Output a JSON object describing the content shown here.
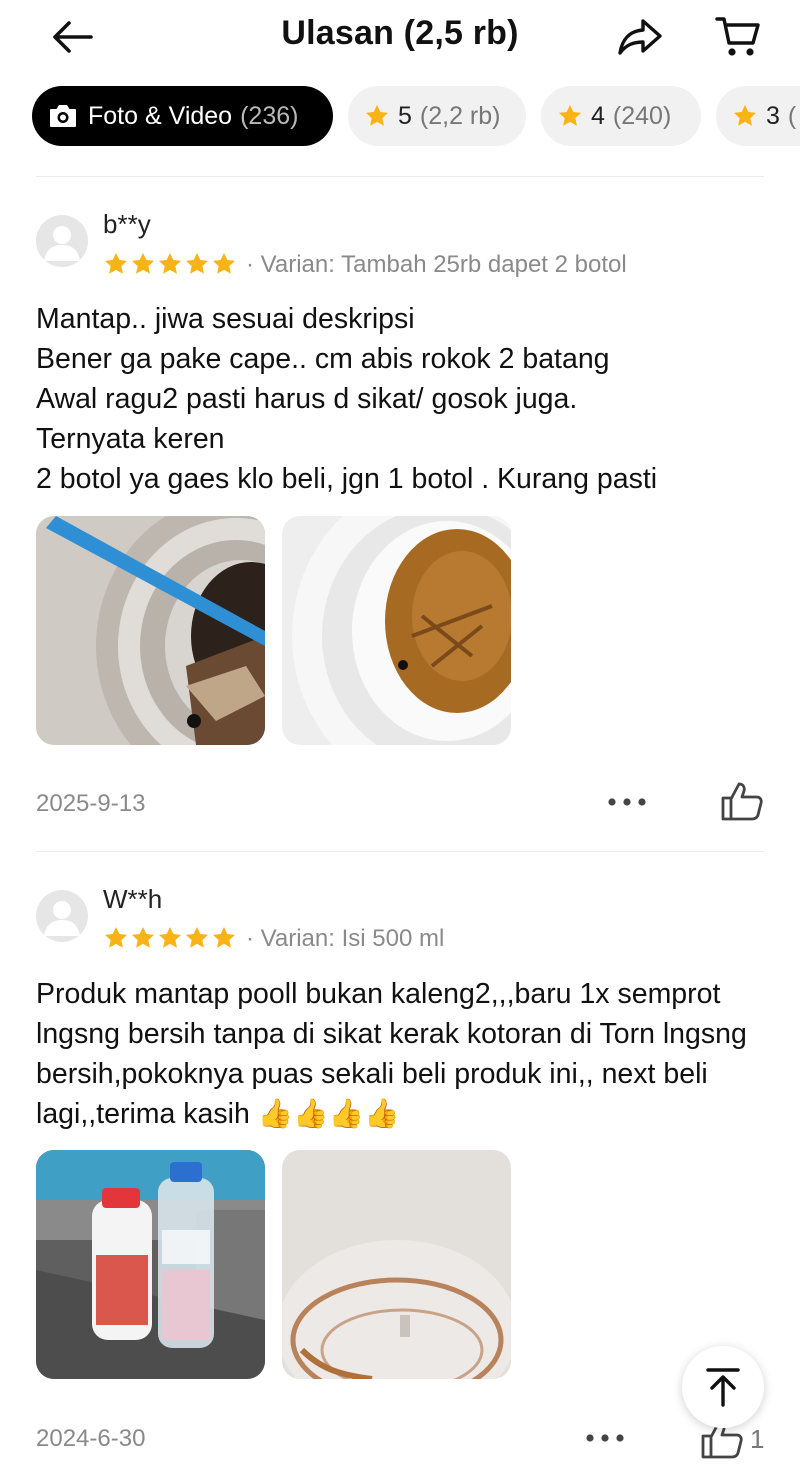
{
  "header": {
    "title": "Ulasan (2,5 rb)",
    "back_icon": "arrow-left-icon",
    "share_icon": "share-icon",
    "cart_icon": "cart-icon"
  },
  "filters": [
    {
      "label": "Foto & Video",
      "count": "(236)",
      "icon": "camera-icon",
      "active": true
    },
    {
      "label": "5",
      "count": "(2,2 rb)",
      "icon": "star-icon"
    },
    {
      "label": "4",
      "count": "(240)",
      "icon": "star-icon"
    },
    {
      "label": "3",
      "count": "(",
      "icon": "star-icon"
    }
  ],
  "colors": {
    "star": "#f9b314",
    "active_chip": "#000000",
    "chip": "#f1f1f1",
    "muted": "#8a8a8a"
  },
  "reviews": [
    {
      "user": "b**y",
      "rating": 5,
      "variant": "· Varian: Tambah 25rb dapet 2 botol",
      "text": "Mantap.. jiwa sesuai deskripsi\nBener ga pake cape.. cm abis rokok 2 batang\nAwal ragu2 pasti harus d sikat/ gosok juga.\nTernyata keren\n2 botol ya gaes klo beli, jgn 1 botol . Kurang pasti",
      "date": "2025-9-13",
      "likes": ""
    },
    {
      "user": "W**h",
      "rating": 5,
      "variant": "· Varian: Isi 500 ml",
      "text": "Produk mantap pooll bukan kaleng2,,,baru 1x semprot lngsng bersih tanpa di sikat kerak kotoran di Torn lngsng bersih,pokoknya puas sekali beli produk ini,, next beli lagi,,terima kasih 👍👍👍👍",
      "date": "2024-6-30",
      "likes": "1"
    }
  ]
}
